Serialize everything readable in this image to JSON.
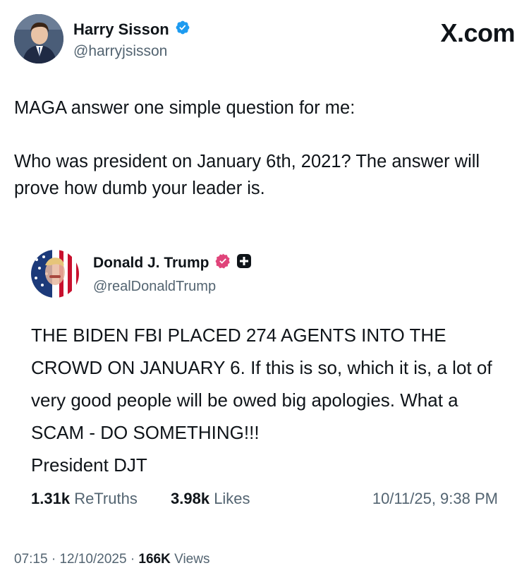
{
  "brand": "X.com",
  "tweet": {
    "author_name": "Harry Sisson",
    "author_handle": "@harryjsisson",
    "text": "MAGA answer one simple question for me:\n\nWho was president on January 6th, 2021? The answer will prove how dumb your leader is."
  },
  "quoted_post": {
    "author_name": "Donald J. Trump",
    "author_handle": "@realDonaldTrump",
    "text": "THE BIDEN FBI PLACED 274 AGENTS INTO THE CROWD ON JANUARY 6. If this is so, which it is, a lot of very good people will be owed big apologies. What a SCAM - DO SOMETHING!!!\nPresident DJT",
    "retruths_count": "1.31k",
    "retruths_label": "ReTruths",
    "likes_count": "3.98k",
    "likes_label": "Likes",
    "timestamp": "10/11/25, 9:38 PM"
  },
  "footer": {
    "time": "07:15",
    "separator": "·",
    "date": "12/10/2025",
    "views_count": "166K",
    "views_label": "Views"
  },
  "colors": {
    "verified_blue": "#1d9bf0",
    "truth_badge_pink": "#e0447a",
    "secondary_text": "#536471",
    "primary_text": "#0f1419"
  },
  "icons": {
    "verified": "verified-badge-icon",
    "truth_verified": "truth-verified-badge-icon",
    "plus_badge": "plus-badge-icon"
  }
}
